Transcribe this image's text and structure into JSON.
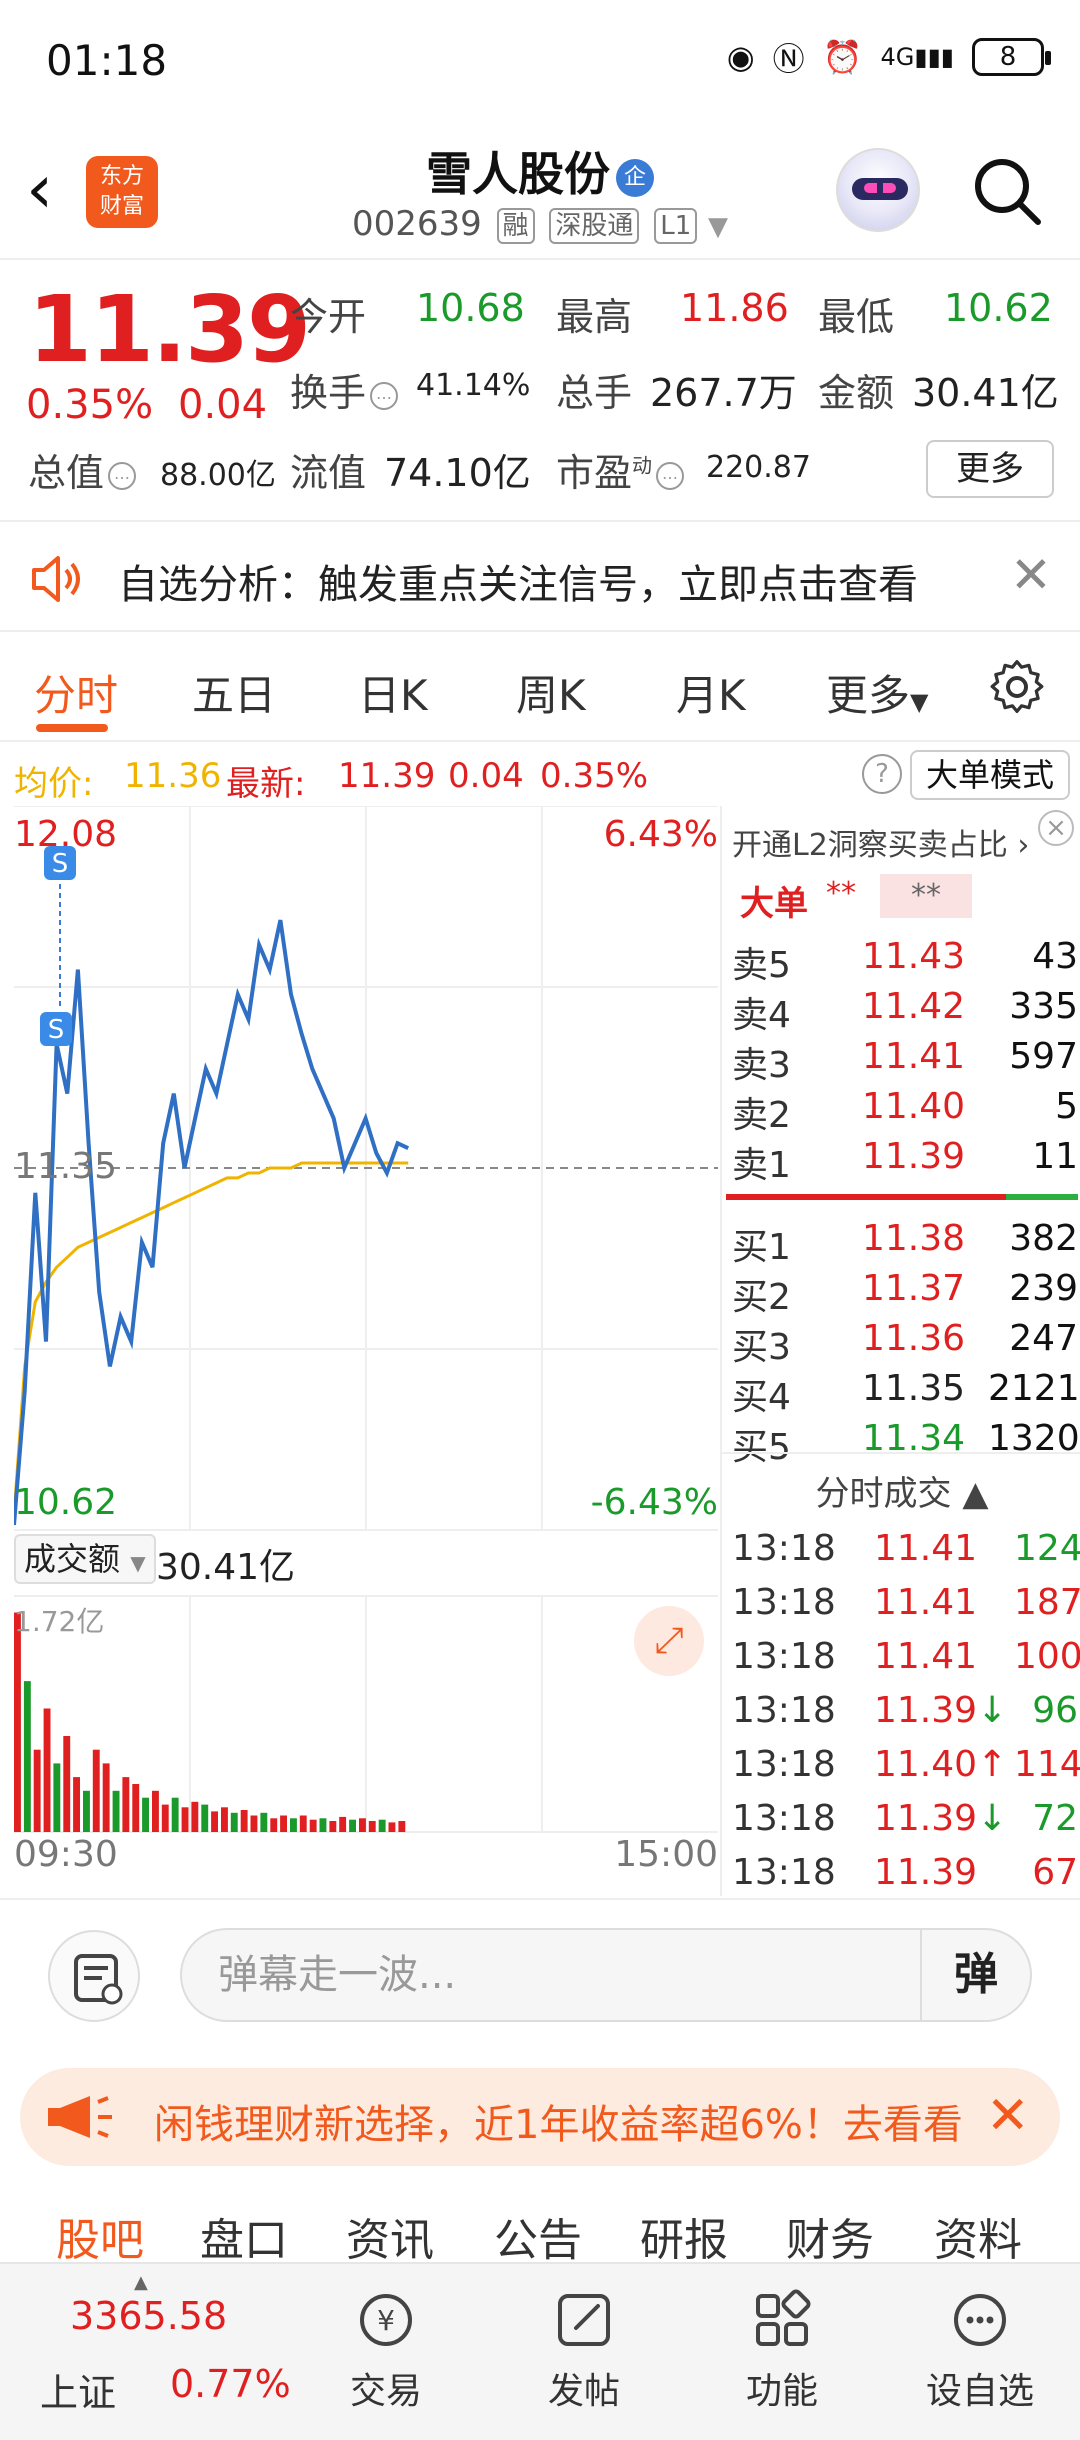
{
  "status_bar": {
    "time": "01:18",
    "network": "4G",
    "battery": "8"
  },
  "header": {
    "logo_text_line1": "东方",
    "logo_text_line2": "财富",
    "stock_name": "雪人股份",
    "badge": "企",
    "code": "002639",
    "tags": [
      "融",
      "深股通",
      "L1"
    ]
  },
  "quote": {
    "price": "11.39",
    "change_pct": "0.35%",
    "change_val": "0.04",
    "open_label": "今开",
    "open": "10.68",
    "high_label": "最高",
    "high": "11.86",
    "low_label": "最低",
    "low": "10.62",
    "turnover_label": "换手",
    "turnover": "41.14%",
    "volume_label": "总手",
    "volume": "267.7万",
    "amount_label": "金额",
    "amount": "30.41亿",
    "mktcap_label": "总值",
    "mktcap": "88.00亿",
    "float_label": "流值",
    "float": "74.10亿",
    "pe_label": "市盈",
    "pe_sup": "动",
    "pe": "220.87",
    "more_label": "更多"
  },
  "notice": {
    "text": "自选分析：触发重点关注信号，立即点击查看"
  },
  "tabs": {
    "items": [
      "分时",
      "五日",
      "日K",
      "周K",
      "月K",
      "更多"
    ],
    "active": "分时"
  },
  "avg_row": {
    "avg_label": "均价:",
    "avg": "11.36",
    "latest_label": "最新:",
    "latest": "11.39",
    "chg": "0.04",
    "pct": "0.35%",
    "big_order_mode": "大单模式"
  },
  "chart_data": {
    "type": "line",
    "series": [
      {
        "name": "price",
        "values": [
          10.63,
          10.9,
          11.3,
          11.0,
          11.6,
          11.5,
          11.75,
          11.4,
          11.1,
          10.95,
          11.05,
          11.0,
          11.2,
          11.15,
          11.4,
          11.5,
          11.35,
          11.45,
          11.55,
          11.5,
          11.6,
          11.7,
          11.65,
          11.8,
          11.75,
          11.85,
          11.7,
          11.62,
          11.55,
          11.5,
          11.45,
          11.35,
          11.4,
          11.45,
          11.38,
          11.34,
          11.4,
          11.39
        ]
      },
      {
        "name": "avg",
        "values": [
          10.65,
          10.95,
          11.08,
          11.12,
          11.15,
          11.17,
          11.19,
          11.2,
          11.21,
          11.22,
          11.23,
          11.24,
          11.25,
          11.26,
          11.27,
          11.28,
          11.29,
          11.3,
          11.31,
          11.32,
          11.33,
          11.33,
          11.34,
          11.34,
          11.35,
          11.35,
          11.35,
          11.36,
          11.36,
          11.36,
          11.36,
          11.36,
          11.36,
          11.36,
          11.36,
          11.36,
          11.36,
          11.36
        ]
      }
    ],
    "y_top": "12.08",
    "y_bottom": "10.62",
    "y_mid": "11.35",
    "pct_top": "6.43%",
    "pct_bottom": "-6.43%",
    "ylim": [
      10.62,
      12.08
    ],
    "volume_label": "成交额",
    "volume_total": "30.41亿",
    "volume_max": "1.72亿",
    "volume_bars": [
      1.6,
      1.1,
      0.6,
      0.9,
      0.5,
      0.7,
      0.4,
      0.3,
      0.6,
      0.5,
      0.3,
      0.4,
      0.35,
      0.25,
      0.3,
      0.2,
      0.25,
      0.18,
      0.22,
      0.2,
      0.15,
      0.18,
      0.14,
      0.16,
      0.12,
      0.14,
      0.1,
      0.12,
      0.1,
      0.12,
      0.09,
      0.1,
      0.08,
      0.11,
      0.09,
      0.1,
      0.08,
      0.09,
      0.07,
      0.08
    ],
    "time_start": "09:30",
    "time_end": "15:00"
  },
  "orderbook": {
    "header": "开通L2洞察买卖占比 ›",
    "dadan": "大单",
    "stars": "**",
    "sells": [
      {
        "label": "卖5",
        "price": "11.43",
        "vol": "43",
        "color": "red"
      },
      {
        "label": "卖4",
        "price": "11.42",
        "vol": "335",
        "color": "red"
      },
      {
        "label": "卖3",
        "price": "11.41",
        "vol": "597",
        "color": "red"
      },
      {
        "label": "卖2",
        "price": "11.40",
        "vol": "5",
        "color": "red"
      },
      {
        "label": "卖1",
        "price": "11.39",
        "vol": "11",
        "color": "red"
      }
    ],
    "buys": [
      {
        "label": "买1",
        "price": "11.38",
        "vol": "382",
        "color": "red"
      },
      {
        "label": "买2",
        "price": "11.37",
        "vol": "239",
        "color": "red"
      },
      {
        "label": "买3",
        "price": "11.36",
        "vol": "247",
        "color": "red"
      },
      {
        "label": "买4",
        "price": "11.35",
        "vol": "2121",
        "color": "black"
      },
      {
        "label": "买5",
        "price": "11.34",
        "vol": "1320",
        "color": "green"
      }
    ],
    "ticks_header": "分时成交 ▲",
    "ticks": [
      {
        "time": "13:18",
        "price": "11.41",
        "arrow": "",
        "vol": "124",
        "color": "green"
      },
      {
        "time": "13:18",
        "price": "11.41",
        "arrow": "",
        "vol": "187",
        "color": "red"
      },
      {
        "time": "13:18",
        "price": "11.41",
        "arrow": "",
        "vol": "100",
        "color": "red"
      },
      {
        "time": "13:18",
        "price": "11.39",
        "arrow": "↓",
        "vol": "96",
        "color": "green"
      },
      {
        "time": "13:18",
        "price": "11.40",
        "arrow": "↑",
        "vol": "114",
        "color": "red"
      },
      {
        "time": "13:18",
        "price": "11.39",
        "arrow": "↓",
        "vol": "72",
        "color": "green"
      },
      {
        "time": "13:18",
        "price": "11.39",
        "arrow": "",
        "vol": "67",
        "color": "red"
      }
    ]
  },
  "comment_bar": {
    "placeholder": "弹幕走一波...",
    "danmu_btn": "弹"
  },
  "ad": {
    "text": "闲钱理财新选择，近1年收益率超6%！去看看"
  },
  "section_tabs": [
    "股吧",
    "盘口",
    "资讯",
    "公告",
    "研报",
    "财务",
    "资料"
  ],
  "bottom_nav": {
    "index_value": "3365.58",
    "index_name": "上证",
    "index_pct": "0.77%",
    "items": [
      "交易",
      "发帖",
      "功能",
      "设自选"
    ]
  },
  "colors": {
    "up": "#e02020",
    "down": "#1a9a2a",
    "accent": "#f25a1d",
    "price_line": "#2f6fc4",
    "avg_line": "#f0b400"
  }
}
